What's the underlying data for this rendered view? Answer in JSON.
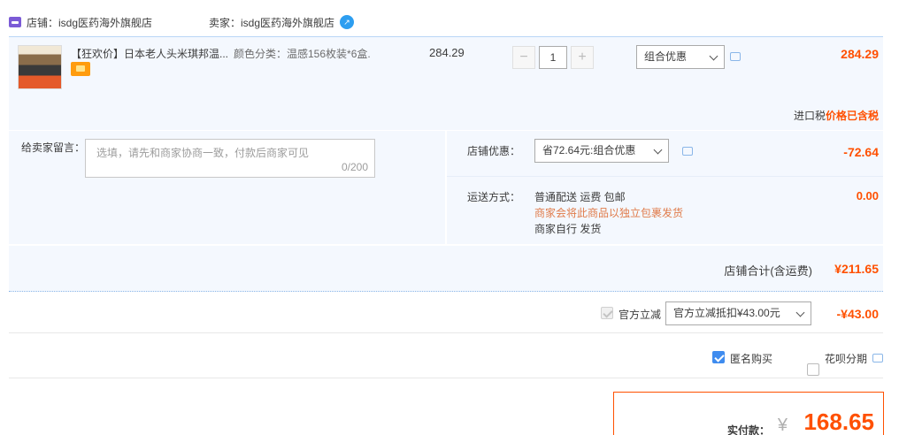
{
  "header": {
    "shop_label": "店铺：",
    "shop_name": "isdg医药海外旗舰店",
    "seller_label": "卖家：",
    "seller_name": "isdg医药海外旗舰店",
    "contact_icon": "wangwang-chat-icon"
  },
  "item": {
    "title": "【狂欢价】日本老人头米琪邦温...",
    "sku": "颜色分类：温感156枚装*6盒.",
    "unit_price": "284.29",
    "quantity": "1",
    "minus": "−",
    "plus": "+",
    "promo_select": "组合优惠",
    "total": "284.29",
    "tax_label": "进口税",
    "tax_value": "价格已含税"
  },
  "message": {
    "label": "给卖家留言：",
    "placeholder": "选填，请先和商家协商一致，付款后商家可见",
    "count": "0/200"
  },
  "shop_promo": {
    "label": "店铺优惠：",
    "select": "省72.64元:组合优惠",
    "value": "-72.64"
  },
  "shipping": {
    "label": "运送方式：",
    "line1": "普通配送 运费 包邮",
    "line2": "商家会将此商品以独立包裹发货",
    "line3": "商家自行  发货",
    "value": "0.00"
  },
  "subtotal": {
    "label": "店铺合计(含运费)",
    "value": "¥211.65"
  },
  "official": {
    "label": "官方立减",
    "select": "官方立减抵扣¥43.00元",
    "value": "-¥43.00"
  },
  "options": {
    "anonymous": "匿名购买",
    "huabei": "花呗分期"
  },
  "pay": {
    "label": "实付款：",
    "currency": "¥",
    "amount": "168.65"
  },
  "colors": {
    "accent": "#ff5000",
    "panel": "#f4f8fe",
    "link_blue": "#3f8cef"
  }
}
